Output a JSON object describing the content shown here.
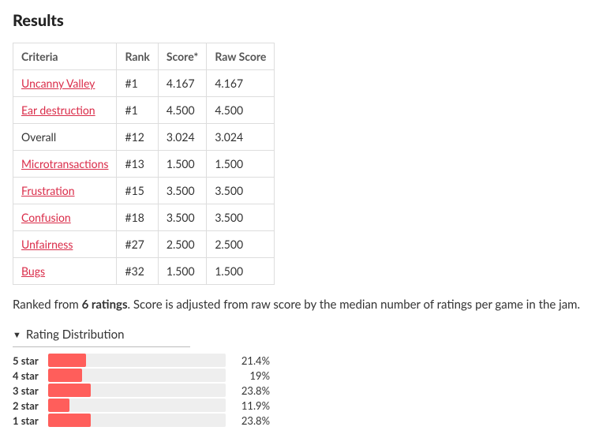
{
  "title": "Results",
  "table": {
    "headers": [
      "Criteria",
      "Rank",
      "Score*",
      "Raw Score"
    ],
    "rows": [
      {
        "criteria": "Uncanny Valley",
        "link": true,
        "rank": "#1",
        "score": "4.167",
        "raw": "4.167"
      },
      {
        "criteria": "Ear destruction",
        "link": true,
        "rank": "#1",
        "score": "4.500",
        "raw": "4.500"
      },
      {
        "criteria": "Overall",
        "link": false,
        "rank": "#12",
        "score": "3.024",
        "raw": "3.024"
      },
      {
        "criteria": "Microtransactions",
        "link": true,
        "rank": "#13",
        "score": "1.500",
        "raw": "1.500"
      },
      {
        "criteria": "Frustration",
        "link": true,
        "rank": "#15",
        "score": "3.500",
        "raw": "3.500"
      },
      {
        "criteria": "Confusion",
        "link": true,
        "rank": "#18",
        "score": "3.500",
        "raw": "3.500"
      },
      {
        "criteria": "Unfairness",
        "link": true,
        "rank": "#27",
        "score": "2.500",
        "raw": "2.500"
      },
      {
        "criteria": "Bugs",
        "link": true,
        "rank": "#32",
        "score": "1.500",
        "raw": "1.500"
      }
    ]
  },
  "ranked_note": {
    "prefix": "Ranked from ",
    "count": "6 ratings",
    "suffix": ". Score is adjusted from raw score by the median number of ratings per game in the jam."
  },
  "distribution": {
    "title": "Rating Distribution",
    "rows": [
      {
        "label": "5 star",
        "pct": 21.4,
        "pct_label": "21.4%"
      },
      {
        "label": "4 star",
        "pct": 19,
        "pct_label": "19%"
      },
      {
        "label": "3 star",
        "pct": 23.8,
        "pct_label": "23.8%"
      },
      {
        "label": "2 star",
        "pct": 11.9,
        "pct_label": "11.9%"
      },
      {
        "label": "1 star",
        "pct": 23.8,
        "pct_label": "23.8%"
      }
    ]
  }
}
